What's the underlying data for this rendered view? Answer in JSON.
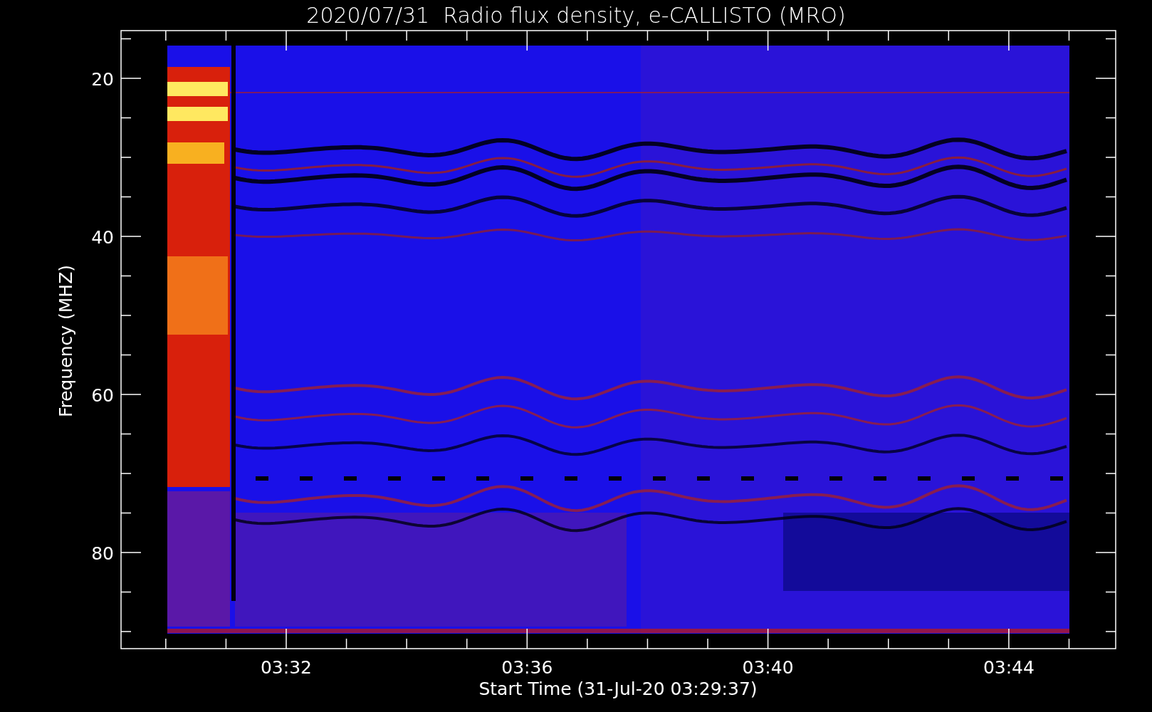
{
  "title": "2020/07/31  Radio flux density, e-CALLISTO (MRO)",
  "y_axis": {
    "label": "Frequency (MHZ)",
    "ticks": [
      "20",
      "40",
      "60",
      "80"
    ]
  },
  "x_axis": {
    "label": "Start Time (31-Jul-20 03:29:37)",
    "ticks": [
      "03:32",
      "03:36",
      "03:40",
      "03:44"
    ]
  }
}
